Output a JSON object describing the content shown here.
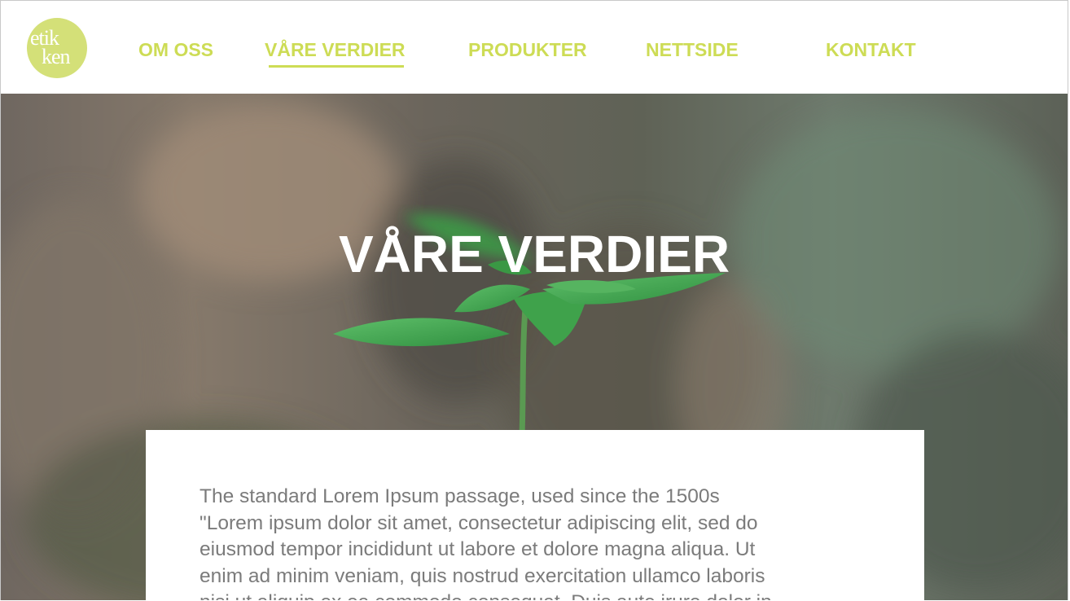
{
  "logo": {
    "line1": "etik",
    "line2": "ken"
  },
  "nav": {
    "items": [
      {
        "label": "OM OSS"
      },
      {
        "label": "VÅRE VERDIER"
      },
      {
        "label": "PRODUKTER"
      },
      {
        "label": "NETTSIDE"
      },
      {
        "label": "KONTAKT"
      }
    ],
    "active_index": 1
  },
  "hero": {
    "title": "VÅRE VERDIER"
  },
  "content": {
    "body": "The standard Lorem Ipsum passage, used since the 1500s\n\"Lorem ipsum dolor sit amet, consectetur adipiscing elit, sed do\neiusmod tempor incididunt ut labore et dolore magna aliqua. Ut\nenim ad minim veniam, quis nostrud exercitation ullamco laboris\nnisi ut aliquip ex ea commodo consequat. Duis aute irure dolor in"
  },
  "colors": {
    "accent": "#cddc55",
    "logo_bg": "#d4e078",
    "body_text": "#7b7b7b"
  }
}
